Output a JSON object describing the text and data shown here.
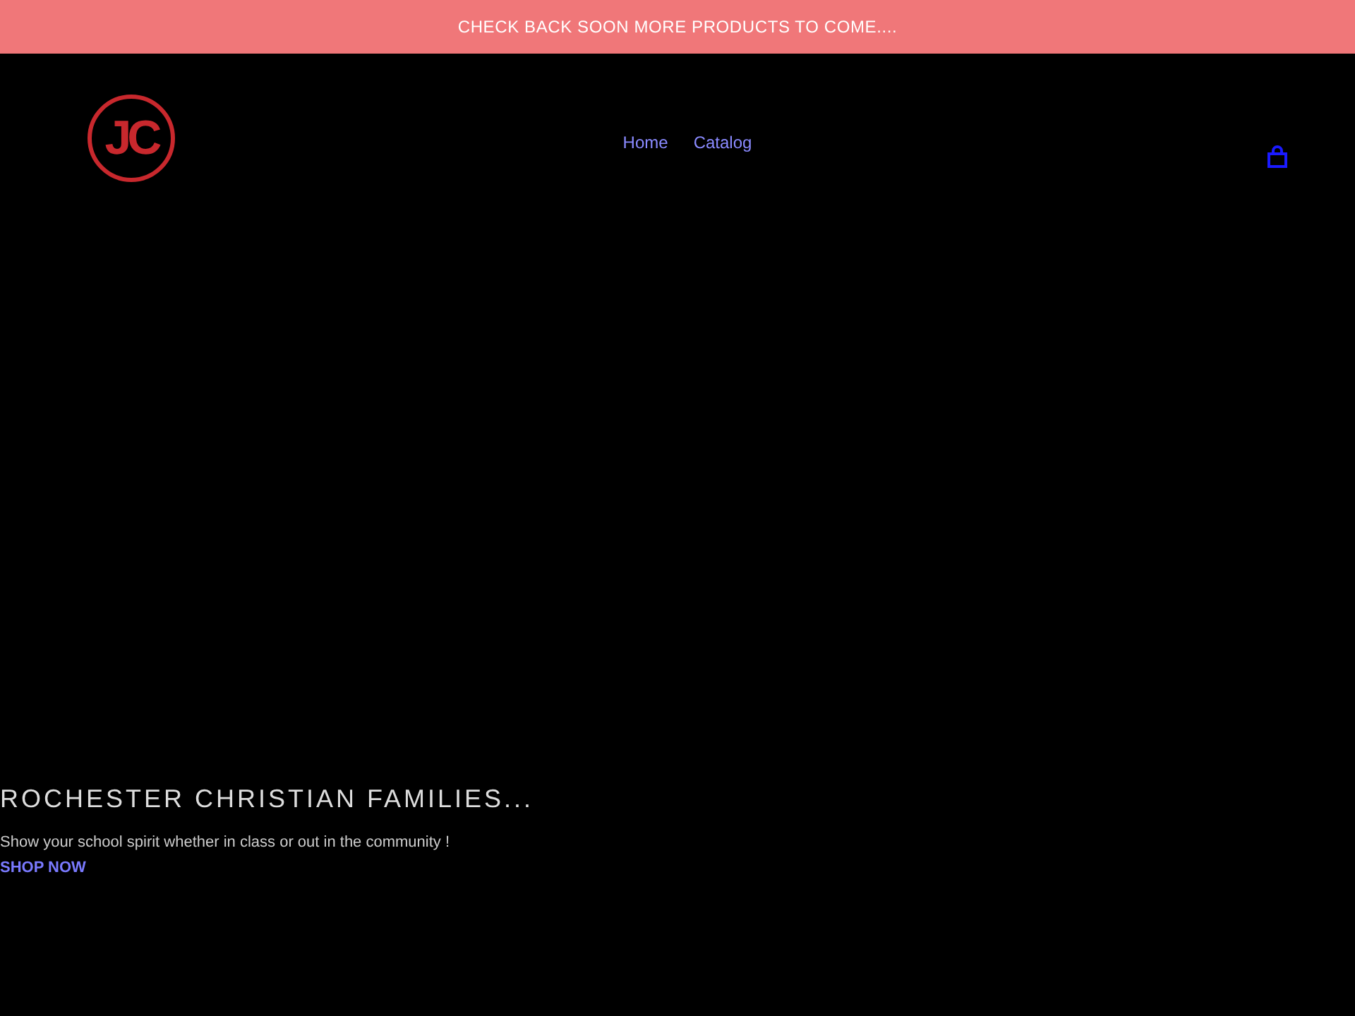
{
  "announcement": {
    "text": "CHECK BACK SOON MORE PRODUCTS TO COME...."
  },
  "header": {
    "logo": {
      "text": "JC"
    },
    "nav": [
      {
        "label": "Home"
      },
      {
        "label": "Catalog"
      }
    ]
  },
  "hero": {
    "heading": "ROCHESTER CHRISTIAN FAMILIES...",
    "subtext": "Show your school spirit whether in class or out in the community !",
    "cta": "SHOP NOW"
  }
}
